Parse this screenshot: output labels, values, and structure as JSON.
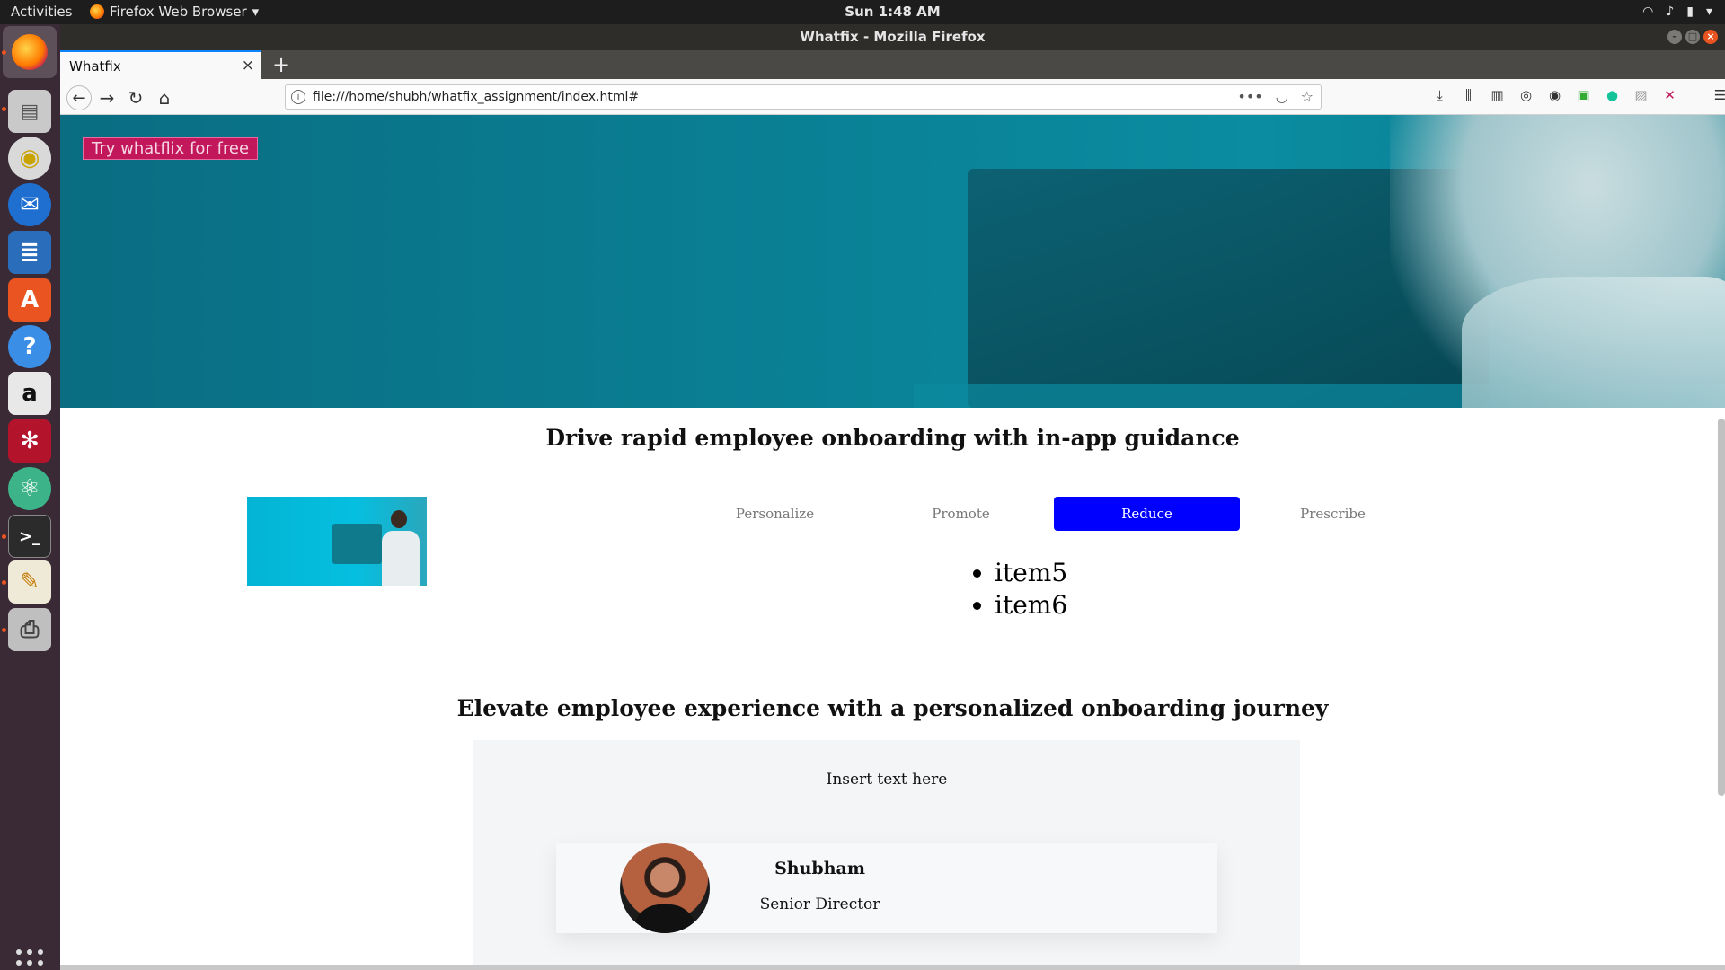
{
  "system": {
    "activities": "Activities",
    "app_menu": "Firefox Web Browser",
    "clock": "Sun  1:48 AM"
  },
  "window": {
    "title": "Whatfix - Mozilla Firefox"
  },
  "browser": {
    "tab_title": "Whatfix",
    "url": "file:///home/shubh/whatfix_assignment/index.html#"
  },
  "page": {
    "cta_label": "Try whatflix for free",
    "section1_title": "Drive rapid employee onboarding with in-app guidance",
    "tabs": [
      "Personalize",
      "Promote",
      "Reduce",
      "Prescribe"
    ],
    "active_tab": "Reduce",
    "tab_items": [
      "item5",
      "item6"
    ],
    "section2_title": "Elevate employee experience with a personalized onboarding journey",
    "testimonial": {
      "text": "Insert text here",
      "name": "Shubham",
      "role": "Senior Director"
    }
  },
  "dock": {
    "items": [
      "firefox-icon",
      "files-icon",
      "rhythmbox-icon",
      "thunderbird-icon",
      "writer-icon",
      "software-icon",
      "help-icon",
      "amazon-icon",
      "mendeley-icon",
      "atom-icon",
      "terminal-icon",
      "text-editor-icon",
      "scanner-icon",
      "show-apps-icon"
    ]
  }
}
